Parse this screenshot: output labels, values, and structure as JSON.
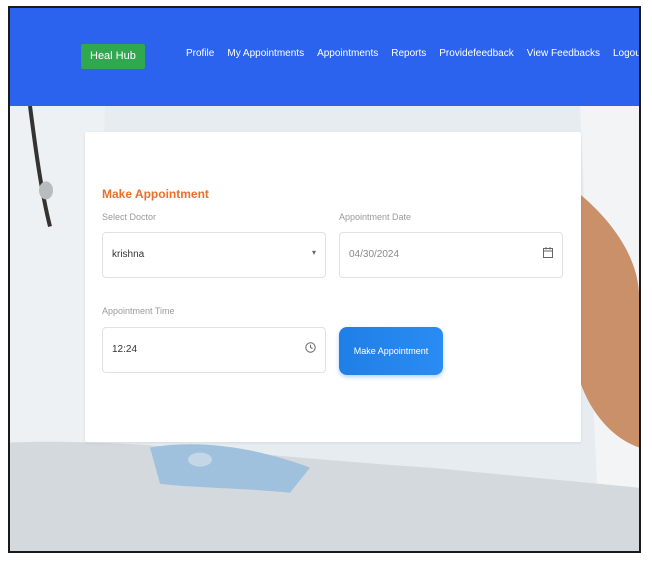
{
  "nav": {
    "brand": "Heal Hub",
    "links": [
      "Profile",
      "My Appointments",
      "Appointments",
      "Reports",
      "Providefeedback",
      "View Feedbacks",
      "Logout"
    ]
  },
  "form": {
    "title": "Make Appointment",
    "doctor_label": "Select Doctor",
    "doctor_value": "krishna",
    "date_label": "Appointment Date",
    "date_value": "04/30/2024",
    "time_label": "Appointment Time",
    "time_value": "12:24",
    "submit_label": "Make Appointment"
  },
  "icons": {
    "select": "chevron-down-icon",
    "date": "calendar-icon",
    "time": "clock-icon"
  },
  "colors": {
    "navbar": "#2b63ee",
    "brand": "#2fa84f",
    "title": "#e8702a",
    "button": "#1f7fe6"
  }
}
